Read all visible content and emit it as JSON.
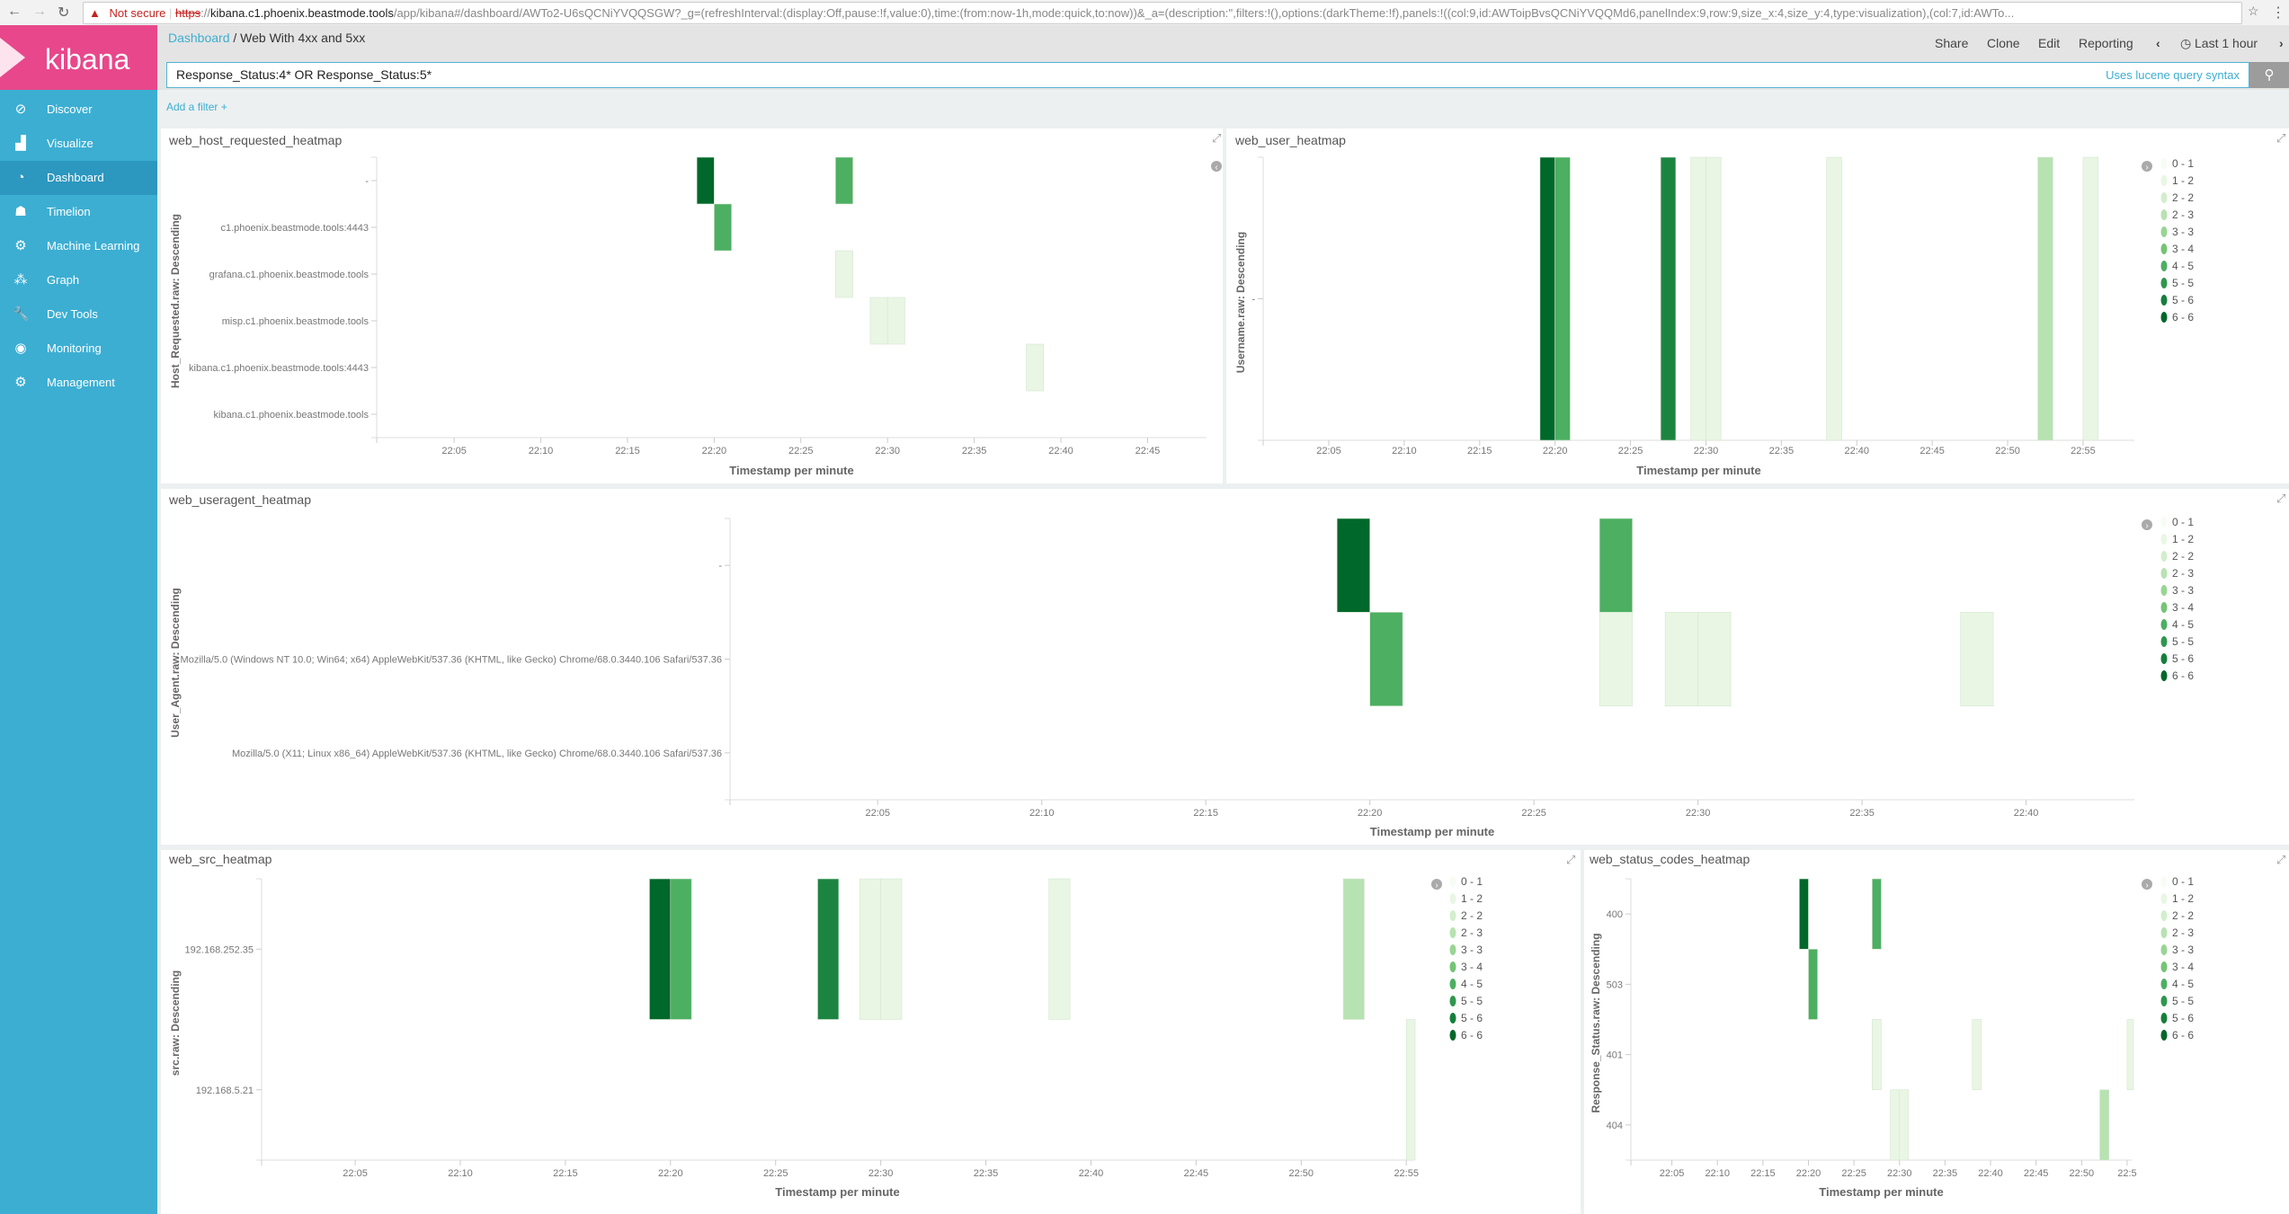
{
  "browser": {
    "security_label": "Not secure",
    "url_scheme": "https",
    "url_host": "kibana.c1.phoenix.beastmode.tools",
    "url_rest": "/app/kibana#/dashboard/AWTo2-U6sQCNiYVQQSGW?_g=(refreshInterval:(display:Off,pause:!f,value:0),time:(from:now-1h,mode:quick,to:now))&_a=(description:'',filters:!(),options:(darkTheme:!f),panels:!((col:9,id:AWToipBvsQCNiYVQQMd6,panelIndex:9,row:9,size_x:4,size_y:4,type:visualization),(col:7,id:AWTo..."
  },
  "sidebar": {
    "logo_text": "kibana",
    "items": [
      {
        "label": "Discover",
        "icon": "compass-icon",
        "glyph": "⊘"
      },
      {
        "label": "Visualize",
        "icon": "bar-chart-icon",
        "glyph": "▟"
      },
      {
        "label": "Dashboard",
        "icon": "dashboard-icon",
        "glyph": "◔",
        "active": true
      },
      {
        "label": "Timelion",
        "icon": "timelion-icon",
        "glyph": "☗"
      },
      {
        "label": "Machine Learning",
        "icon": "machine-learning-icon",
        "glyph": "⚙"
      },
      {
        "label": "Graph",
        "icon": "graph-icon",
        "glyph": "⁂"
      },
      {
        "label": "Dev Tools",
        "icon": "wrench-icon",
        "glyph": "🔧"
      },
      {
        "label": "Monitoring",
        "icon": "eye-icon",
        "glyph": "◉"
      },
      {
        "label": "Management",
        "icon": "gear-icon",
        "glyph": "⚙"
      }
    ]
  },
  "header": {
    "breadcrumb_root": "Dashboard",
    "breadcrumb_sep": "/",
    "breadcrumb_current": "Web With 4xx and 5xx",
    "actions": [
      "Share",
      "Clone",
      "Edit",
      "Reporting"
    ],
    "time_prev": "‹",
    "time_label": "Last 1 hour",
    "time_next": "›"
  },
  "query": {
    "value": "Response_Status:4* OR Response_Status:5*",
    "hint": "Uses lucene query syntax"
  },
  "filters": {
    "add_label": "Add a filter +"
  },
  "colors": {
    "sidebar": "#3caed2",
    "logo": "#e8488b",
    "count_colors": {
      "1": "#e9f6e4",
      "2": "#b7e2b1",
      "4": "#4daf62",
      "5": "#1c8441",
      "6": "#00682a"
    }
  },
  "legend": [
    {
      "label": "0 - 1",
      "color": "#f7fcf5"
    },
    {
      "label": "1 - 2",
      "color": "#e9f6e4"
    },
    {
      "label": "2 - 2",
      "color": "#d3eecd"
    },
    {
      "label": "2 - 3",
      "color": "#b7e2b1"
    },
    {
      "label": "3 - 3",
      "color": "#98d594"
    },
    {
      "label": "3 - 4",
      "color": "#74c476"
    },
    {
      "label": "4 - 5",
      "color": "#4daf62"
    },
    {
      "label": "5 - 5",
      "color": "#2f974e"
    },
    {
      "label": "5 - 6",
      "color": "#157f3b"
    },
    {
      "label": "6 - 6",
      "color": "#00682a"
    }
  ],
  "chart_data": [
    {
      "type": "heatmap",
      "title": "web_host_requested_heatmap",
      "xlabel": "Timestamp per minute",
      "ylabel": "Host_Requested.raw: Descending",
      "x_range": [
        "22:00:32",
        "22:48:24"
      ],
      "x_ticks": [
        "22:05",
        "22:10",
        "22:15",
        "22:20",
        "22:25",
        "22:30",
        "22:35",
        "22:40",
        "22:45"
      ],
      "rows": [
        "-",
        "c1.phoenix.beastmode.tools:4443",
        "grafana.c1.phoenix.beastmode.tools",
        "misp.c1.phoenix.beastmode.tools",
        "kibana.c1.phoenix.beastmode.tools:4443",
        "kibana.c1.phoenix.beastmode.tools"
      ],
      "legend_shown": false,
      "cells": [
        {
          "x": "22:19",
          "y": "-",
          "count": 6
        },
        {
          "x": "22:20",
          "y": "c1.phoenix.beastmode.tools:4443",
          "count": 4
        },
        {
          "x": "22:27",
          "y": "-",
          "count": 4
        },
        {
          "x": "22:27",
          "y": "grafana.c1.phoenix.beastmode.tools",
          "count": 1
        },
        {
          "x": "22:29",
          "y": "misp.c1.phoenix.beastmode.tools",
          "count": 1
        },
        {
          "x": "22:30",
          "y": "misp.c1.phoenix.beastmode.tools",
          "count": 1
        },
        {
          "x": "22:38",
          "y": "kibana.c1.phoenix.beastmode.tools:4443",
          "count": 1
        }
      ]
    },
    {
      "type": "heatmap",
      "title": "web_user_heatmap",
      "xlabel": "Timestamp per minute",
      "ylabel": "Username.raw: Descending",
      "x_range": [
        "22:00:39",
        "22:58:24"
      ],
      "x_ticks": [
        "22:05",
        "22:10",
        "22:15",
        "22:20",
        "22:25",
        "22:30",
        "22:35",
        "22:40",
        "22:45",
        "22:50",
        "22:55"
      ],
      "rows": [
        "-"
      ],
      "legend_shown": true,
      "cells": [
        {
          "x": "22:19",
          "y": "-",
          "count": 6
        },
        {
          "x": "22:20",
          "y": "-",
          "count": 4
        },
        {
          "x": "22:27",
          "y": "-",
          "count": 5
        },
        {
          "x": "22:29",
          "y": "-",
          "count": 1
        },
        {
          "x": "22:30",
          "y": "-",
          "count": 1
        },
        {
          "x": "22:38",
          "y": "-",
          "count": 1
        },
        {
          "x": "22:52",
          "y": "-",
          "count": 2
        },
        {
          "x": "22:55",
          "y": "-",
          "count": 1
        }
      ]
    },
    {
      "type": "heatmap",
      "title": "web_useragent_heatmap",
      "xlabel": "Timestamp per minute",
      "ylabel": "User_Agent.raw: Descending",
      "x_range": [
        "22:00:30",
        "22:43:18"
      ],
      "x_ticks": [
        "22:05",
        "22:10",
        "22:15",
        "22:20",
        "22:25",
        "22:30",
        "22:35",
        "22:40"
      ],
      "rows": [
        "-",
        "Mozilla/5.0 (Windows NT 10.0; Win64; x64) AppleWebKit/537.36 (KHTML, like Gecko) Chrome/68.0.3440.106 Safari/537.36",
        "Mozilla/5.0 (X11; Linux x86_64) AppleWebKit/537.36 (KHTML, like Gecko) Chrome/68.0.3440.106 Safari/537.36"
      ],
      "legend_shown": true,
      "cells": [
        {
          "x": "22:19",
          "y": "-",
          "count": 6
        },
        {
          "x": "22:20",
          "y": "Mozilla/5.0 (Windows NT 10.0; Win64; x64) AppleWebKit/537.36 (KHTML, like Gecko) Chrome/68.0.3440.106 Safari/537.36",
          "count": 4
        },
        {
          "x": "22:27",
          "y": "-",
          "count": 4
        },
        {
          "x": "22:27",
          "y": "Mozilla/5.0 (Windows NT 10.0; Win64; x64) AppleWebKit/537.36 (KHTML, like Gecko) Chrome/68.0.3440.106 Safari/537.36",
          "count": 1
        },
        {
          "x": "22:29",
          "y": "Mozilla/5.0 (Windows NT 10.0; Win64; x64) AppleWebKit/537.36 (KHTML, like Gecko) Chrome/68.0.3440.106 Safari/537.36",
          "count": 1
        },
        {
          "x": "22:30",
          "y": "Mozilla/5.0 (Windows NT 10.0; Win64; x64) AppleWebKit/537.36 (KHTML, like Gecko) Chrome/68.0.3440.106 Safari/537.36",
          "count": 1
        },
        {
          "x": "22:38",
          "y": "Mozilla/5.0 (Windows NT 10.0; Win64; x64) AppleWebKit/537.36 (KHTML, like Gecko) Chrome/68.0.3440.106 Safari/537.36",
          "count": 1
        }
      ]
    },
    {
      "type": "heatmap",
      "title": "web_src_heatmap",
      "xlabel": "Timestamp per minute",
      "ylabel": "src.raw: Descending",
      "x_range": [
        "22:00:33",
        "22:55:20"
      ],
      "x_ticks": [
        "22:05",
        "22:10",
        "22:15",
        "22:20",
        "22:25",
        "22:30",
        "22:35",
        "22:40",
        "22:45",
        "22:50",
        "22:55"
      ],
      "rows": [
        "192.168.252.35",
        "192.168.5.21"
      ],
      "legend_shown": true,
      "cells": [
        {
          "x": "22:19",
          "y": "192.168.252.35",
          "count": 6
        },
        {
          "x": "22:20",
          "y": "192.168.252.35",
          "count": 4
        },
        {
          "x": "22:27",
          "y": "192.168.252.35",
          "count": 5
        },
        {
          "x": "22:29",
          "y": "192.168.252.35",
          "count": 1
        },
        {
          "x": "22:30",
          "y": "192.168.252.35",
          "count": 1
        },
        {
          "x": "22:38",
          "y": "192.168.252.35",
          "count": 1
        },
        {
          "x": "22:52",
          "y": "192.168.252.35",
          "count": 2
        },
        {
          "x": "22:55",
          "y": "192.168.5.21",
          "count": 1
        }
      ]
    },
    {
      "type": "heatmap",
      "title": "web_status_codes_heatmap",
      "xlabel": "Timestamp per minute",
      "ylabel": "Response_Status.raw: Descending",
      "x_range": [
        "22:00:30",
        "22:55:30"
      ],
      "x_ticks": [
        "22:05",
        "22:10",
        "22:15",
        "22:20",
        "22:25",
        "22:30",
        "22:35",
        "22:40",
        "22:45",
        "22:50",
        "22:5"
      ],
      "rows": [
        "400",
        "503",
        "401",
        "404"
      ],
      "legend_shown": true,
      "cells": [
        {
          "x": "22:19",
          "y": "400",
          "count": 6
        },
        {
          "x": "22:20",
          "y": "503",
          "count": 4
        },
        {
          "x": "22:27",
          "y": "400",
          "count": 4
        },
        {
          "x": "22:27",
          "y": "401",
          "count": 1
        },
        {
          "x": "22:29",
          "y": "404",
          "count": 1
        },
        {
          "x": "22:30",
          "y": "404",
          "count": 1
        },
        {
          "x": "22:38",
          "y": "401",
          "count": 1
        },
        {
          "x": "22:52",
          "y": "404",
          "count": 2
        },
        {
          "x": "22:55",
          "y": "401",
          "count": 1
        }
      ]
    }
  ]
}
